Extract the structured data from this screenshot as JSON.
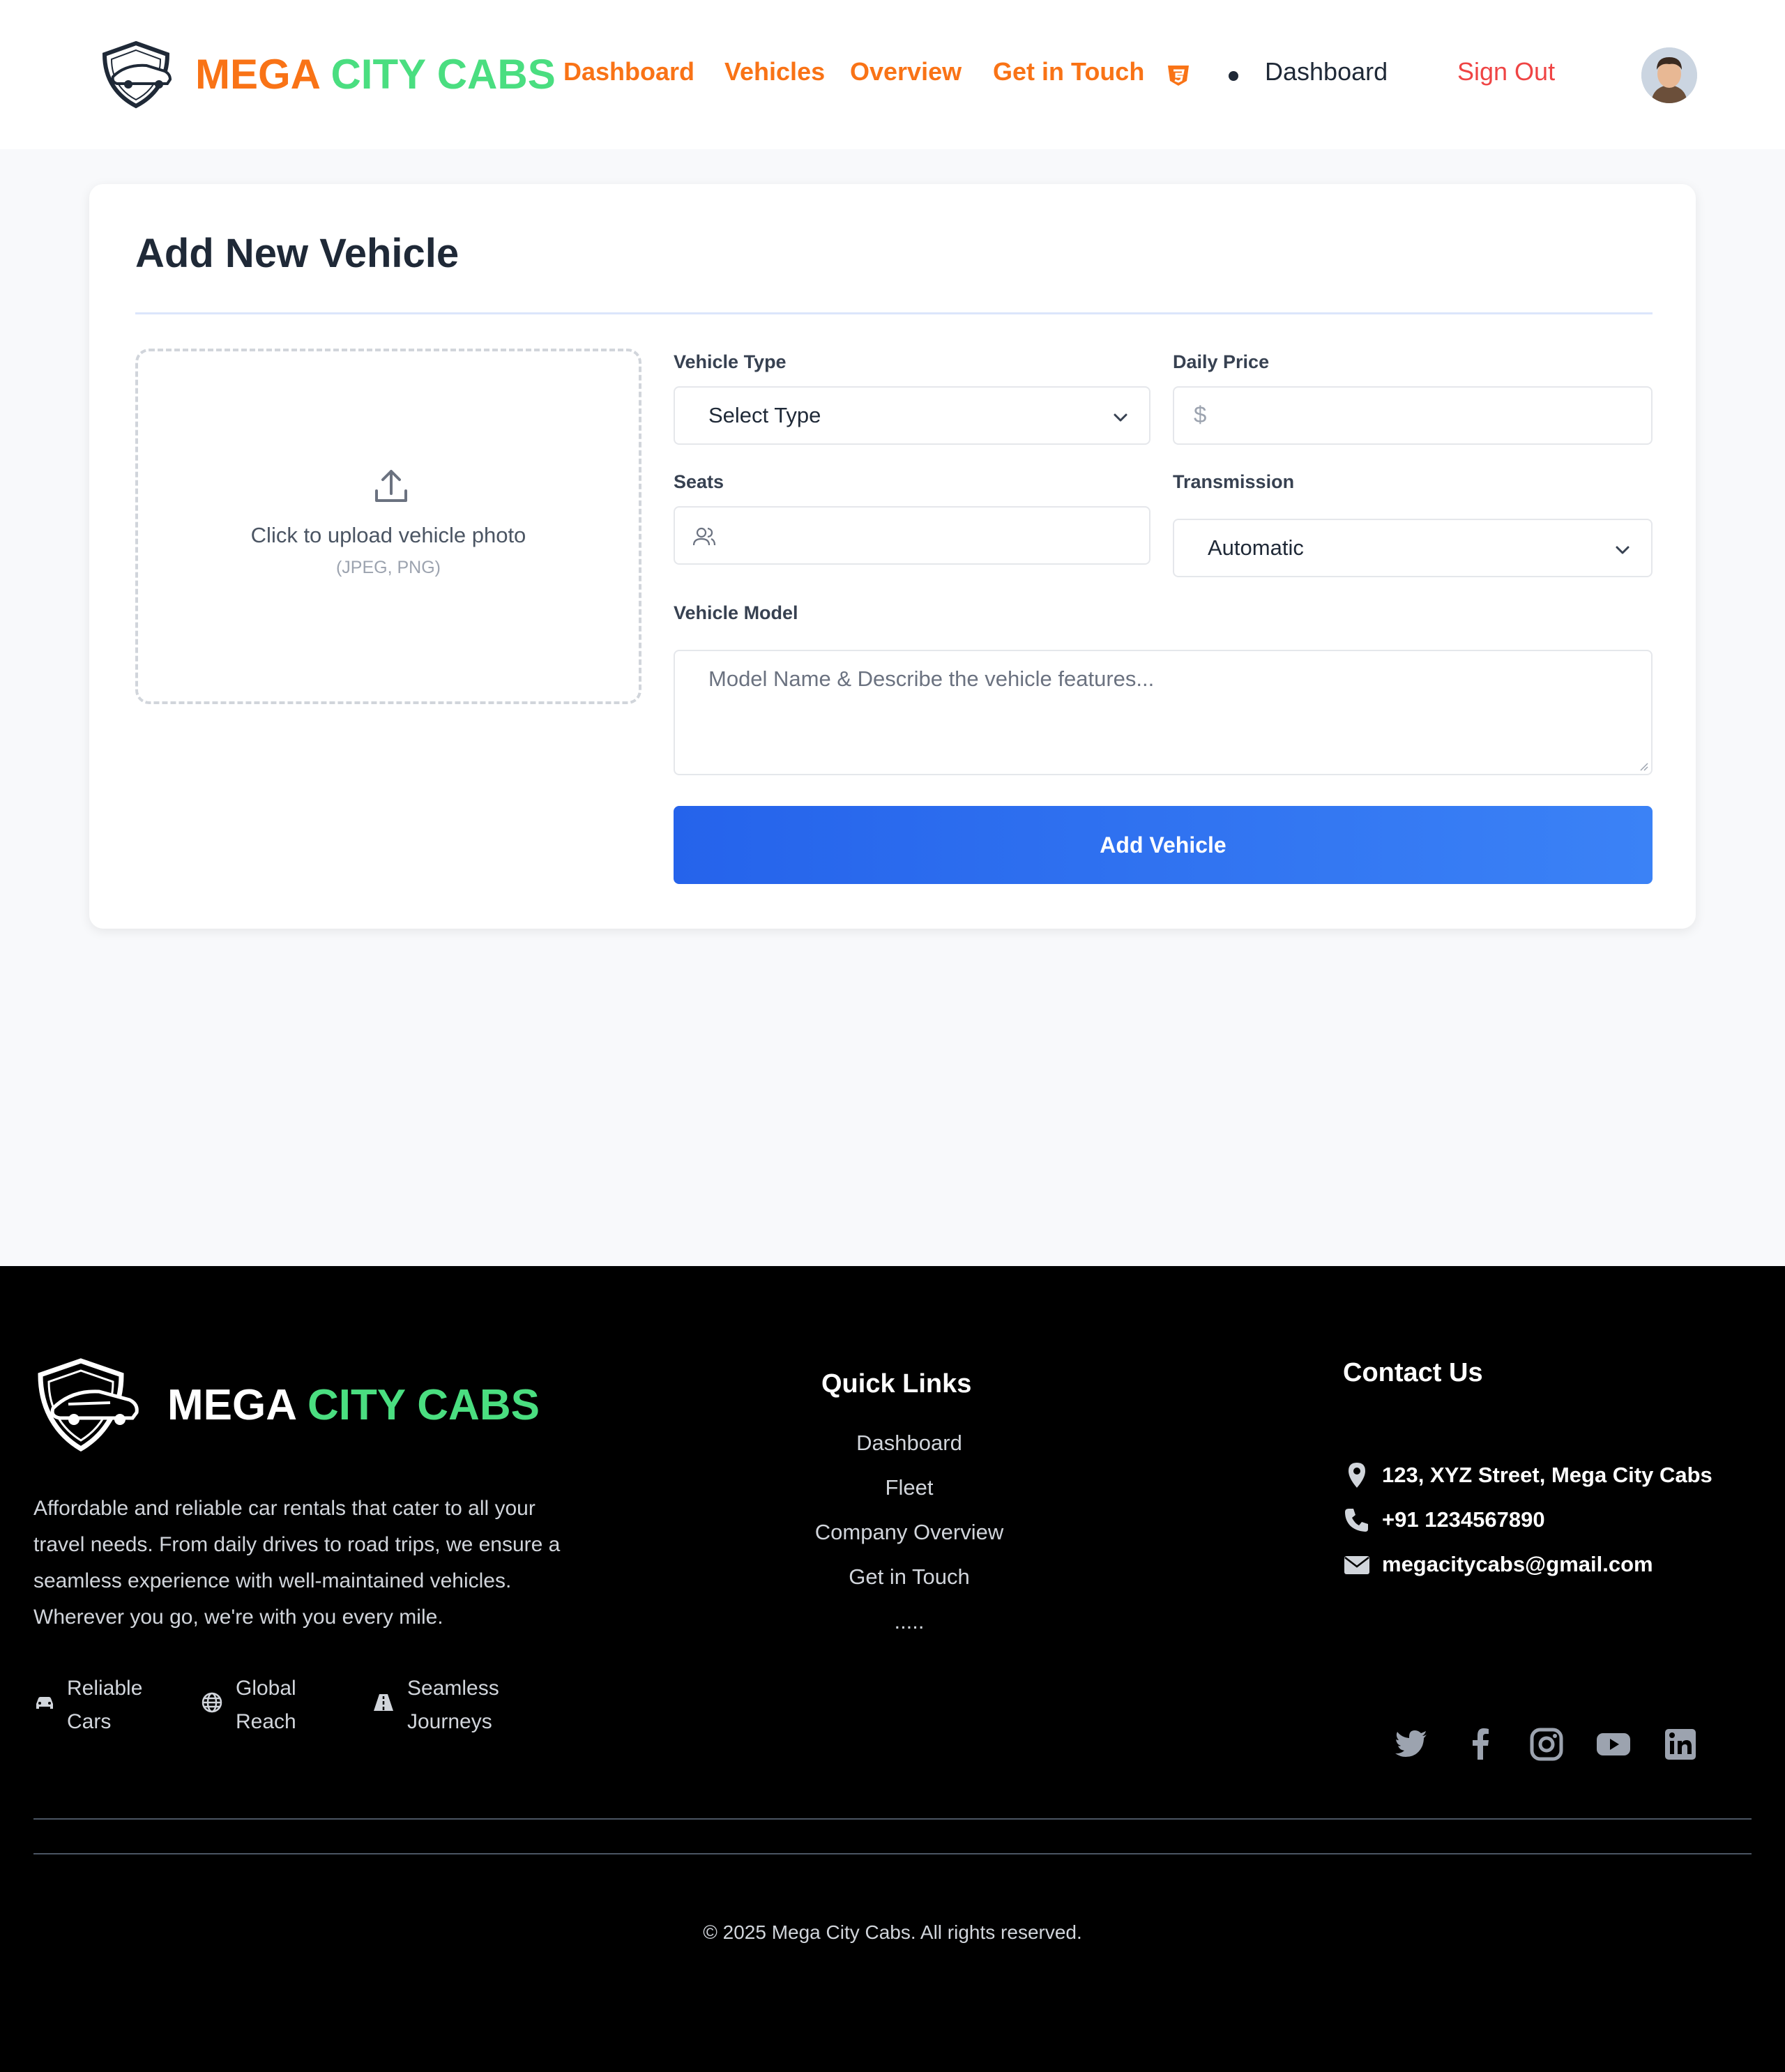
{
  "header": {
    "brand_word1": "MEGA",
    "brand_word2": "CITY CABS",
    "nav": [
      "Dashboard",
      "Vehicles",
      "Overview",
      "Get in Touch"
    ],
    "nav_active": "Dashboard",
    "sign_out": "Sign Out"
  },
  "form": {
    "title": "Add New Vehicle",
    "upload": {
      "text": "Click to upload vehicle photo",
      "formats": "(JPEG, PNG)"
    },
    "vehicle_type": {
      "label": "Vehicle Type",
      "value": "Select Type"
    },
    "daily_price": {
      "label": "Daily Price",
      "prefix": "$",
      "value": ""
    },
    "seats": {
      "label": "Seats",
      "value": ""
    },
    "transmission": {
      "label": "Transmission",
      "value": "Automatic"
    },
    "vehicle_model": {
      "label": "Vehicle Model",
      "placeholder": "Model Name & Describe the vehicle features..."
    },
    "submit": "Add Vehicle"
  },
  "footer": {
    "brand_word1": "MEGA",
    "brand_word2": "CITY CABS",
    "description": "Affordable and reliable car rentals that cater to all your travel needs. From daily drives to road trips, we ensure a seamless experience with well-maintained vehicles. Wherever you go, we're with you every mile.",
    "features": [
      {
        "line1": "Reliable",
        "line2": "Cars",
        "icon": "car-icon"
      },
      {
        "line1": "Global",
        "line2": "Reach",
        "icon": "globe-icon"
      },
      {
        "line1": "Seamless",
        "line2": "Journeys",
        "icon": "road-icon"
      }
    ],
    "quick_links_title": "Quick Links",
    "quick_links": [
      "Dashboard",
      "Fleet",
      "Company Overview",
      "Get in Touch",
      "....."
    ],
    "contact_title": "Contact Us",
    "contact": {
      "address": "123, XYZ Street, Mega City Cabs",
      "phone": "+91 1234567890",
      "email": "megacitycabs@gmail.com"
    },
    "social_icons": [
      "twitter-icon",
      "facebook-icon",
      "instagram-icon",
      "youtube-icon",
      "linkedin-icon"
    ],
    "copyright": "© 2025 Mega City Cabs. All rights reserved."
  },
  "colors": {
    "accent_orange": "#f97316",
    "accent_green": "#4ade80",
    "primary_blue": "#2563eb",
    "signout_red": "#ef4444"
  }
}
